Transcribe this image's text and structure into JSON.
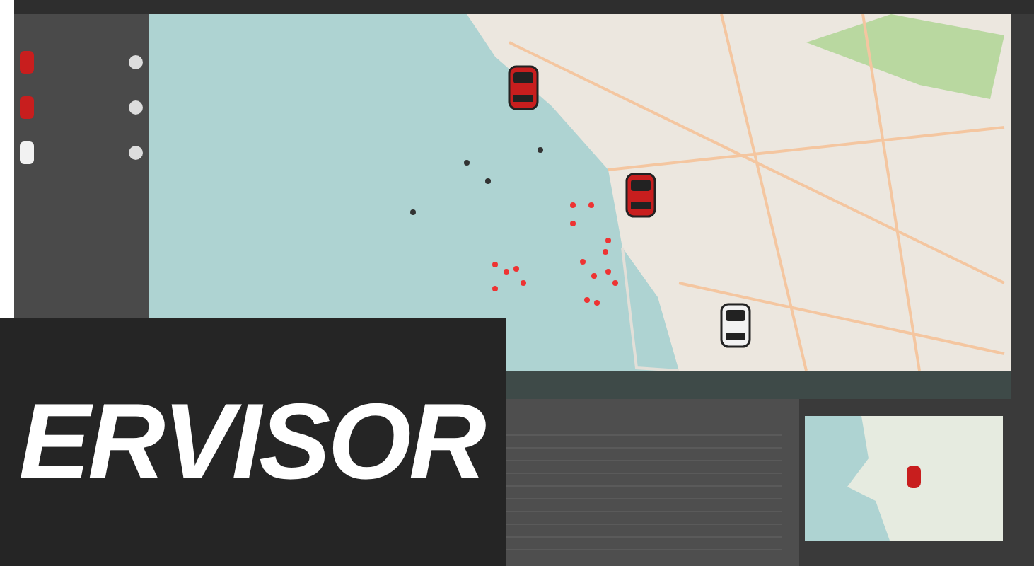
{
  "sidebar": {
    "vehicles": [
      {
        "color": "#c81e1e"
      },
      {
        "color": "#c81e1e"
      },
      {
        "color": "#f2f2f2"
      }
    ]
  },
  "map": {
    "vehicles": [
      {
        "color": "#c81e1e"
      },
      {
        "color": "#c81e1e"
      },
      {
        "color": "#f2f2f2"
      }
    ]
  },
  "minimap": {
    "vehicle": {
      "color": "#c81e1e"
    }
  },
  "banner": {
    "text": "ERVISOR"
  }
}
